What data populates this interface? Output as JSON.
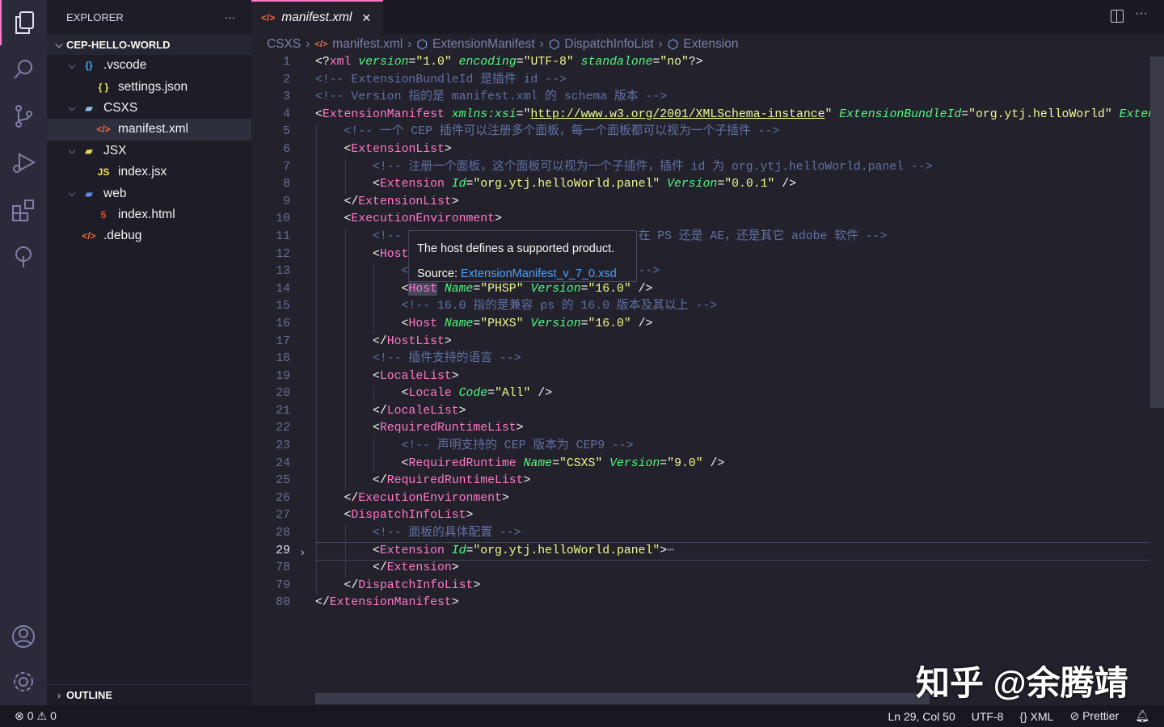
{
  "activity": [
    "explorer-icon",
    "search-icon",
    "source-control-icon",
    "run-debug-icon",
    "extensions-icon",
    "remote-icon",
    "account-icon",
    "gear-icon"
  ],
  "sidebar": {
    "title": "EXPLORER",
    "more": "···",
    "root": "CEP-HELLO-WORLD",
    "outline": "OUTLINE",
    "items": [
      {
        "label": ".vscode",
        "icon": "{}",
        "kind": "folder",
        "depth": 1,
        "icolor": "#3fa9f5"
      },
      {
        "label": "settings.json",
        "icon": "{ }",
        "kind": "file",
        "depth": 2,
        "icolor": "#f1e05a"
      },
      {
        "label": "CSXS",
        "icon": "▰",
        "kind": "folder",
        "depth": 1,
        "icolor": "#8fc3e8"
      },
      {
        "label": "manifest.xml",
        "icon": "</>",
        "kind": "file",
        "depth": 2,
        "icolor": "#f26b3a",
        "selected": true
      },
      {
        "label": "JSX",
        "icon": "▰",
        "kind": "folder",
        "depth": 1,
        "icolor": "#e8d85a"
      },
      {
        "label": "index.jsx",
        "icon": "JS",
        "kind": "file",
        "depth": 2,
        "icolor": "#f1e05a"
      },
      {
        "label": "web",
        "icon": "▰",
        "kind": "folder",
        "depth": 1,
        "icolor": "#5b8fe0"
      },
      {
        "label": "index.html",
        "icon": "5",
        "kind": "file",
        "depth": 2,
        "icolor": "#e44d26"
      },
      {
        "label": ".debug",
        "icon": "</>",
        "kind": "file",
        "depth": 1,
        "icolor": "#f26b3a"
      }
    ]
  },
  "tab": {
    "label": "manifest.xml",
    "icon": "</>",
    "close": "✕"
  },
  "breadcrumb": [
    "CSXS",
    "manifest.xml",
    "ExtensionManifest",
    "DispatchInfoList",
    "Extension"
  ],
  "editor": {
    "current_line": 29,
    "lines": [
      {
        "n": "1",
        "i": 0,
        "t": [
          [
            "p",
            "<?"
          ],
          [
            "tg",
            "xml"
          ],
          [
            "p",
            " "
          ],
          [
            "a",
            "version"
          ],
          [
            "p",
            "="
          ],
          [
            "s",
            "\"1.0\""
          ],
          [
            "p",
            " "
          ],
          [
            "a",
            "encoding"
          ],
          [
            "p",
            "="
          ],
          [
            "s",
            "\"UTF-8\""
          ],
          [
            "p",
            " "
          ],
          [
            "a",
            "standalone"
          ],
          [
            "p",
            "="
          ],
          [
            "s",
            "\"no\""
          ],
          [
            "p",
            "?>"
          ]
        ]
      },
      {
        "n": "2",
        "i": 0,
        "t": [
          [
            "c",
            "<!-- ExtensionBundleId 是插件 id -->"
          ]
        ]
      },
      {
        "n": "3",
        "i": 0,
        "t": [
          [
            "c",
            "<!-- Version 指的是 manifest.xml 的 schema 版本 -->"
          ]
        ]
      },
      {
        "n": "4",
        "i": 0,
        "t": [
          [
            "p",
            "<"
          ],
          [
            "tg",
            "ExtensionManifest"
          ],
          [
            "p",
            " "
          ],
          [
            "a",
            "xmlns:xsi"
          ],
          [
            "p",
            "=\""
          ],
          [
            "u",
            "http://www.w3.org/2001/XMLSchema-instance"
          ],
          [
            "s",
            "\""
          ],
          [
            "p",
            " "
          ],
          [
            "a",
            "ExtensionBundleId"
          ],
          [
            "p",
            "="
          ],
          [
            "s",
            "\"org.ytj.helloWorld\""
          ],
          [
            "p",
            " "
          ],
          [
            "a",
            "Extens"
          ]
        ]
      },
      {
        "n": "5",
        "i": 1,
        "t": [
          [
            "c",
            "<!-- 一个 CEP 插件可以注册多个面板，每一个面板都可以视为一个子插件 -->"
          ]
        ]
      },
      {
        "n": "6",
        "i": 1,
        "t": [
          [
            "p",
            "<"
          ],
          [
            "tg",
            "ExtensionList"
          ],
          [
            "p",
            ">"
          ]
        ]
      },
      {
        "n": "7",
        "i": 2,
        "t": [
          [
            "c",
            "<!-- 注册一个面板，这个面板可以视为一个子插件，插件 id 为 org.ytj.helloWorld.panel -->"
          ]
        ]
      },
      {
        "n": "8",
        "i": 2,
        "t": [
          [
            "p",
            "<"
          ],
          [
            "tg",
            "Extension"
          ],
          [
            "p",
            " "
          ],
          [
            "a",
            "Id"
          ],
          [
            "p",
            "="
          ],
          [
            "s",
            "\"org.ytj.helloWorld.panel\""
          ],
          [
            "p",
            " "
          ],
          [
            "a",
            "Version"
          ],
          [
            "p",
            "="
          ],
          [
            "s",
            "\"0.0.1\""
          ],
          [
            "p",
            " />"
          ]
        ]
      },
      {
        "n": "9",
        "i": 1,
        "t": [
          [
            "p",
            "</"
          ],
          [
            "tg",
            "ExtensionList"
          ],
          [
            "p",
            ">"
          ]
        ]
      },
      {
        "n": "10",
        "i": 1,
        "t": [
          [
            "p",
            "<"
          ],
          [
            "tg",
            "ExecutionEnvironment"
          ],
          [
            "p",
            ">"
          ]
        ]
      },
      {
        "n": "11",
        "i": 2,
        "t": [
          [
            "c",
            "<!--"
          ],
          [
            "p",
            "                                 "
          ],
          [
            "c",
            "在 PS 还是 AE，还是其它 adobe 软件 -->"
          ]
        ]
      },
      {
        "n": "12",
        "i": 2,
        "t": [
          [
            "p",
            "<"
          ],
          [
            "tg",
            "Host"
          ]
        ]
      },
      {
        "n": "13",
        "i": 3,
        "t": [
          [
            "c",
            "<"
          ],
          [
            "p",
            "                                "
          ],
          [
            "c",
            "-->"
          ]
        ]
      },
      {
        "n": "14",
        "i": 3,
        "t": [
          [
            "p",
            "<"
          ],
          [
            "hl",
            "Host"
          ],
          [
            "p",
            " "
          ],
          [
            "a",
            "Name"
          ],
          [
            "p",
            "="
          ],
          [
            "s",
            "\"PHSP\""
          ],
          [
            "p",
            " "
          ],
          [
            "a",
            "Version"
          ],
          [
            "p",
            "="
          ],
          [
            "s",
            "\"16.0\""
          ],
          [
            "p",
            " />"
          ]
        ]
      },
      {
        "n": "15",
        "i": 3,
        "t": [
          [
            "c",
            "<!-- 16.0 指的是兼容 ps 的 16.0 版本及其以上 -->"
          ]
        ]
      },
      {
        "n": "16",
        "i": 3,
        "t": [
          [
            "p",
            "<"
          ],
          [
            "tg",
            "Host"
          ],
          [
            "p",
            " "
          ],
          [
            "a",
            "Name"
          ],
          [
            "p",
            "="
          ],
          [
            "s",
            "\"PHXS\""
          ],
          [
            "p",
            " "
          ],
          [
            "a",
            "Version"
          ],
          [
            "p",
            "="
          ],
          [
            "s",
            "\"16.0\""
          ],
          [
            "p",
            " />"
          ]
        ]
      },
      {
        "n": "17",
        "i": 2,
        "t": [
          [
            "p",
            "</"
          ],
          [
            "tg",
            "HostList"
          ],
          [
            "p",
            ">"
          ]
        ]
      },
      {
        "n": "18",
        "i": 2,
        "t": [
          [
            "c",
            "<!-- 插件支持的语言 -->"
          ]
        ]
      },
      {
        "n": "19",
        "i": 2,
        "t": [
          [
            "p",
            "<"
          ],
          [
            "tg",
            "LocaleList"
          ],
          [
            "p",
            ">"
          ]
        ]
      },
      {
        "n": "20",
        "i": 3,
        "t": [
          [
            "p",
            "<"
          ],
          [
            "tg",
            "Locale"
          ],
          [
            "p",
            " "
          ],
          [
            "a",
            "Code"
          ],
          [
            "p",
            "="
          ],
          [
            "s",
            "\"All\""
          ],
          [
            "p",
            " />"
          ]
        ]
      },
      {
        "n": "21",
        "i": 2,
        "t": [
          [
            "p",
            "</"
          ],
          [
            "tg",
            "LocaleList"
          ],
          [
            "p",
            ">"
          ]
        ]
      },
      {
        "n": "22",
        "i": 2,
        "t": [
          [
            "p",
            "<"
          ],
          [
            "tg",
            "RequiredRuntimeList"
          ],
          [
            "p",
            ">"
          ]
        ]
      },
      {
        "n": "23",
        "i": 3,
        "t": [
          [
            "c",
            "<!-- 声明支持的 CEP 版本为 CEP9 -->"
          ]
        ]
      },
      {
        "n": "24",
        "i": 3,
        "t": [
          [
            "p",
            "<"
          ],
          [
            "tg",
            "RequiredRuntime"
          ],
          [
            "p",
            " "
          ],
          [
            "a",
            "Name"
          ],
          [
            "p",
            "="
          ],
          [
            "s",
            "\"CSXS\""
          ],
          [
            "p",
            " "
          ],
          [
            "a",
            "Version"
          ],
          [
            "p",
            "="
          ],
          [
            "s",
            "\"9.0\""
          ],
          [
            "p",
            " />"
          ]
        ]
      },
      {
        "n": "25",
        "i": 2,
        "t": [
          [
            "p",
            "</"
          ],
          [
            "tg",
            "RequiredRuntimeList"
          ],
          [
            "p",
            ">"
          ]
        ]
      },
      {
        "n": "26",
        "i": 1,
        "t": [
          [
            "p",
            "</"
          ],
          [
            "tg",
            "ExecutionEnvironment"
          ],
          [
            "p",
            ">"
          ]
        ]
      },
      {
        "n": "27",
        "i": 1,
        "t": [
          [
            "p",
            "<"
          ],
          [
            "tg",
            "DispatchInfoList"
          ],
          [
            "p",
            ">"
          ]
        ]
      },
      {
        "n": "28",
        "i": 2,
        "t": [
          [
            "c",
            "<!-- 面板的具体配置 -->"
          ]
        ]
      },
      {
        "n": "29",
        "i": 2,
        "fold": true,
        "t": [
          [
            "p",
            "<"
          ],
          [
            "tg",
            "Extension"
          ],
          [
            "p",
            " "
          ],
          [
            "a",
            "Id"
          ],
          [
            "p",
            "="
          ],
          [
            "s",
            "\"org.ytj.helloWorld.panel\""
          ],
          [
            "p",
            ">"
          ],
          [
            "e",
            "⋯"
          ]
        ]
      },
      {
        "n": "78",
        "i": 2,
        "t": [
          [
            "p",
            "</"
          ],
          [
            "tg",
            "Extension"
          ],
          [
            "p",
            ">"
          ]
        ]
      },
      {
        "n": "79",
        "i": 1,
        "t": [
          [
            "p",
            "</"
          ],
          [
            "tg",
            "DispatchInfoList"
          ],
          [
            "p",
            ">"
          ]
        ]
      },
      {
        "n": "80",
        "i": 0,
        "t": [
          [
            "p",
            "</"
          ],
          [
            "tg",
            "ExtensionManifest"
          ],
          [
            "p",
            ">"
          ]
        ]
      }
    ]
  },
  "tooltip": {
    "text": "The host defines a supported product.",
    "source_label": "Source: ",
    "source_link": "ExtensionManifest_v_7_0.xsd"
  },
  "status": {
    "errors": "0",
    "warnings": "0",
    "position": "Ln 29, Col 50",
    "encoding": "UTF-8",
    "language": "XML",
    "formatter": "Prettier"
  },
  "watermark": "知乎 @余腾靖",
  "colors": {
    "accent": "#ff79c6",
    "tag": "#ff79c6",
    "attribute": "#50fa7b",
    "string": "#f1fa8c",
    "comment": "#6272a4",
    "link": "#4aa3ff"
  }
}
